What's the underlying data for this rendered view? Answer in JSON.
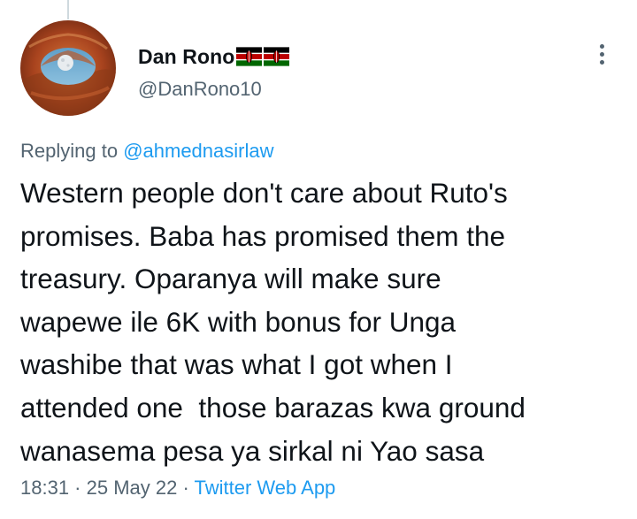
{
  "tweet": {
    "author": {
      "display_name": "Dan Rono",
      "handle": "@DanRono10",
      "flags": [
        "kenya-flag",
        "kenya-flag"
      ]
    },
    "replying_prefix": "Replying to ",
    "replying_to": "@ahmednasirlaw",
    "text_lines": [
      "Western people don't care about Ruto's",
      "promises. Baba has promised them the",
      "treasury. Oparanya will make sure",
      "wapewe ile 6K with bonus for Unga",
      "washibe that was what I got when I",
      "attended one  those barazas kwa ground",
      "wanasema pesa ya sirkal ni Yao sasa"
    ],
    "time": "18:31",
    "separator": " · ",
    "date": "25 May 22",
    "source": "Twitter Web App"
  },
  "icons": {
    "more": "more-options-icon"
  },
  "colors": {
    "text": "#0f1419",
    "secondary": "#536471",
    "link": "#1d9bf0",
    "background": "#ffffff"
  }
}
